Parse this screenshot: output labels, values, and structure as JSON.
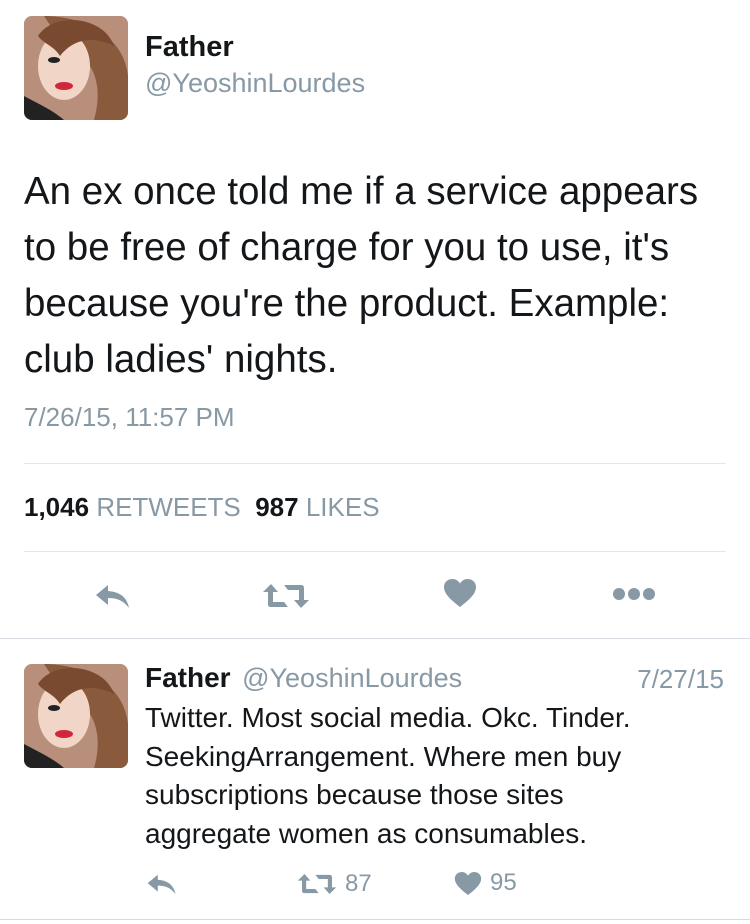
{
  "main_tweet": {
    "author_name": "Father",
    "author_handle": "@YeoshinLourdes",
    "text": "An ex once told me if a service appears\nto be free of charge for you to use, it's\nbecause you're the product. Example:\nclub ladies' nights.",
    "timestamp": "7/26/15, 11:57 PM",
    "retweet_count": "1,046",
    "retweet_label": "RETWEETS",
    "like_count": "987",
    "like_label": "LIKES",
    "actions": [
      "reply-icon",
      "retweet-icon",
      "heart-icon",
      "more-icon"
    ]
  },
  "reply_tweet": {
    "author_name": "Father",
    "author_handle": "@YeoshinLourdes",
    "date": "7/27/15",
    "text": "Twitter. Most social media. Okc. Tinder.\nSeekingArrangement. Where men buy\nsubscriptions because those sites\naggregate women as consumables.",
    "retweet_count": "87",
    "like_count": "95"
  },
  "colors": {
    "text": "#14171a",
    "secondary": "#8899a6",
    "icon": "#8899a6",
    "divider": "#e1e8ed"
  }
}
